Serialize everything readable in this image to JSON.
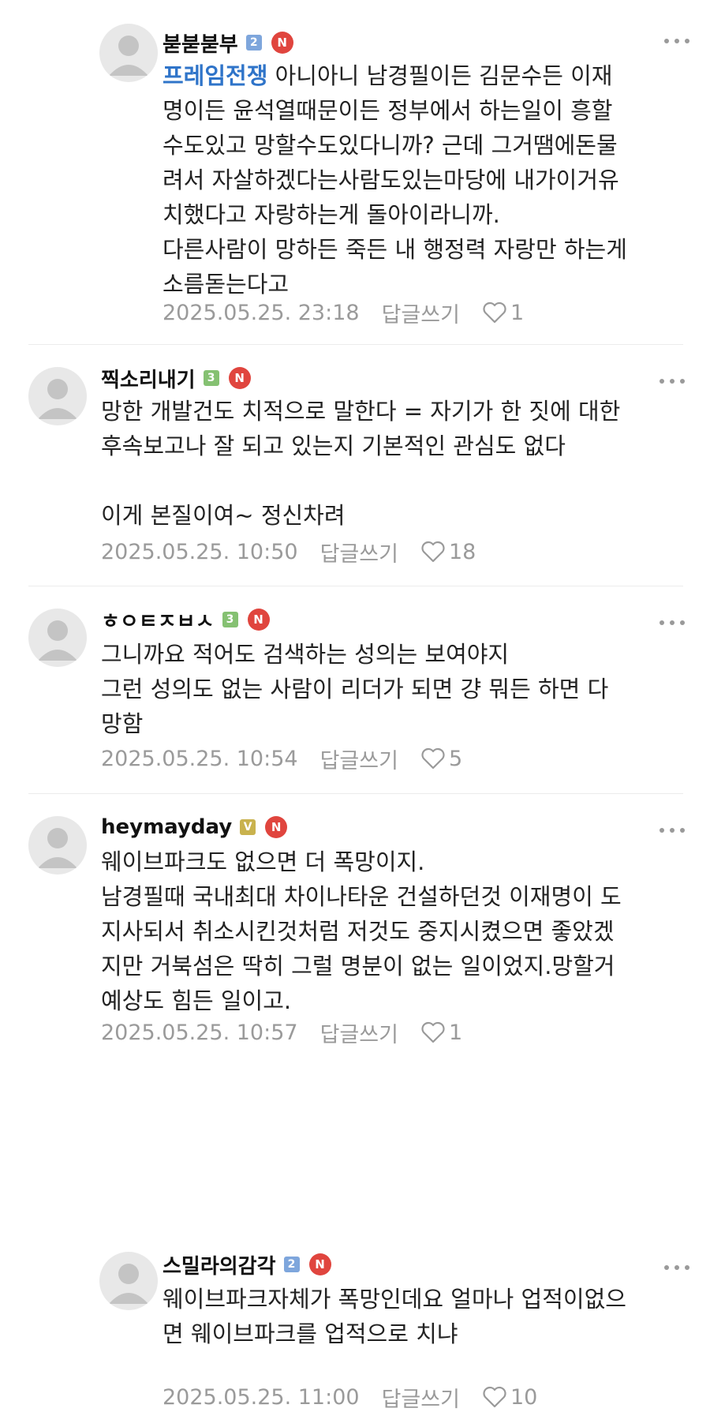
{
  "comments": [
    {
      "nickname": "붇붇붇부",
      "level": "2",
      "badge": "N",
      "mention": "프레임전쟁",
      "text": "아니아니 남경필이든 김문수든 이재\n명이든 윤석열때문이든 정부에서 하는일이 흥할\n수도있고 망할수도있다니까? 근데 그거땜에돈물\n려서 자살하겠다는사람도있는마당에 내가이거유\n치했다고 자랑하는게 돌아이라니까.\n다른사람이 망하든 죽든 내 행정력 자랑만 하는게\n소름돋는다고",
      "date": "2025.05.25. 23:18",
      "reply_label": "답글쓰기",
      "likes": "1"
    },
    {
      "nickname": "찍소리내기",
      "level": "3",
      "badge": "N",
      "text": "망한 개발건도 치적으로 말한다 = 자기가 한 짓에 대한\n후속보고나 잘 되고 있는지 기본적인 관심도 없다\n\n이게 본질이여~ 정신차려",
      "date": "2025.05.25. 10:50",
      "reply_label": "답글쓰기",
      "likes": "18"
    },
    {
      "nickname": "ㅎㅇㅌㅈㅂㅅ",
      "level": "3",
      "badge": "N",
      "text": "그니까요 적어도 검색하는 성의는 보여야지\n그런 성의도 없는 사람이 리더가 되면 걍 뭐든 하면 다\n망함",
      "date": "2025.05.25. 10:54",
      "reply_label": "답글쓰기",
      "likes": "5"
    },
    {
      "nickname": "heymayday",
      "level": "V",
      "badge": "N",
      "text": "웨이브파크도 없으면 더 폭망이지.\n남경필때 국내최대 차이나타운 건설하던것 이재명이 도\n지사되서 취소시킨것처럼 저것도 중지시켰으면 좋았겠\n지만 거북섬은 딱히 그럴 명분이 없는 일이었지.망할거\n예상도 힘든 일이고.",
      "date": "2025.05.25. 10:57",
      "reply_label": "답글쓰기",
      "likes": "1"
    },
    {
      "nickname": "스밀라의감각",
      "level": "2",
      "badge": "N",
      "text": "웨이브파크자체가 폭망인데요 얼마나 업적이없으\n면 웨이브파크를 업적으로 치냐",
      "date": "2025.05.25. 11:00",
      "reply_label": "답글쓰기",
      "likes": "10"
    }
  ],
  "icons": {
    "more": "more-dots-icon",
    "like": "heart-outline-icon",
    "avatar": "default-avatar-icon"
  },
  "colors": {
    "mention": "#2f74c9",
    "badge": "#e0453e",
    "meta": "#9a9a9a"
  }
}
